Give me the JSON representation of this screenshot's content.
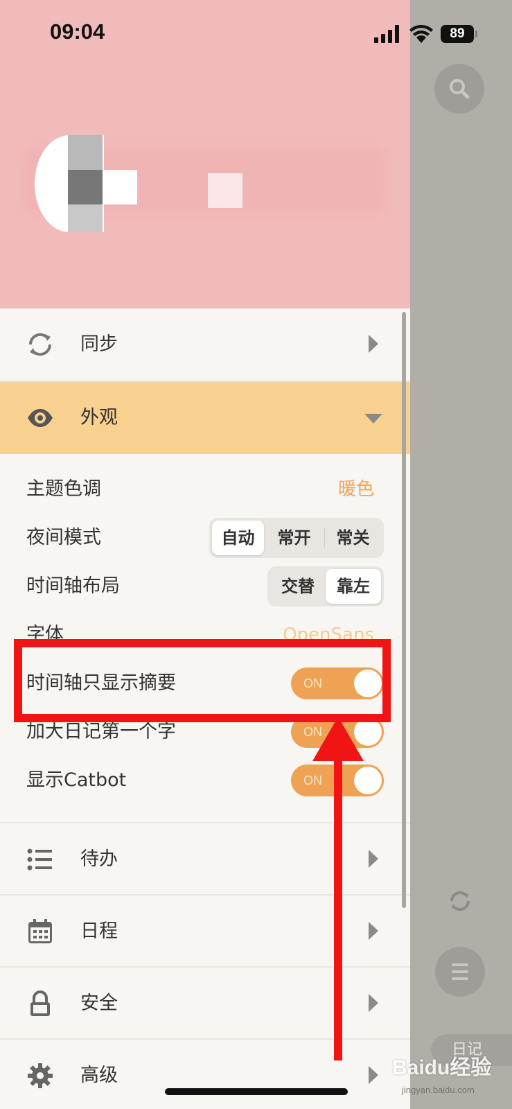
{
  "status_bar": {
    "time": "09:04",
    "battery": "89"
  },
  "menu": {
    "sync": {
      "label": "同步"
    },
    "appearance": {
      "label": "外观"
    },
    "todo": {
      "label": "待办"
    },
    "schedule": {
      "label": "日程"
    },
    "security": {
      "label": "安全"
    },
    "advanced": {
      "label": "高级"
    }
  },
  "settings": {
    "theme": {
      "label": "主题色调",
      "value": "暖色"
    },
    "night_mode": {
      "label": "夜间模式",
      "options": [
        "自动",
        "常开",
        "常关"
      ],
      "selected": "自动"
    },
    "timeline_layout": {
      "label": "时间轴布局",
      "options": [
        "交替",
        "靠左"
      ],
      "selected": "靠左"
    },
    "font": {
      "label": "字体",
      "value": "OpenSans"
    },
    "summary_only": {
      "label": "时间轴只显示摘要",
      "state": "ON"
    },
    "enlarge_first_char": {
      "label": "加大日记第一个字",
      "state": "ON"
    },
    "show_catbot": {
      "label": "显示Catbot",
      "state": "ON"
    }
  },
  "right_pane": {
    "diary_tab": "日记"
  },
  "watermark": {
    "brand": "Baidu经验",
    "url": "jingyan.baidu.com"
  },
  "colors": {
    "accent": "#efa253",
    "appearance_bg": "#f8d08f",
    "header_bg": "#f2bbbb",
    "annotation": "#f01414"
  }
}
